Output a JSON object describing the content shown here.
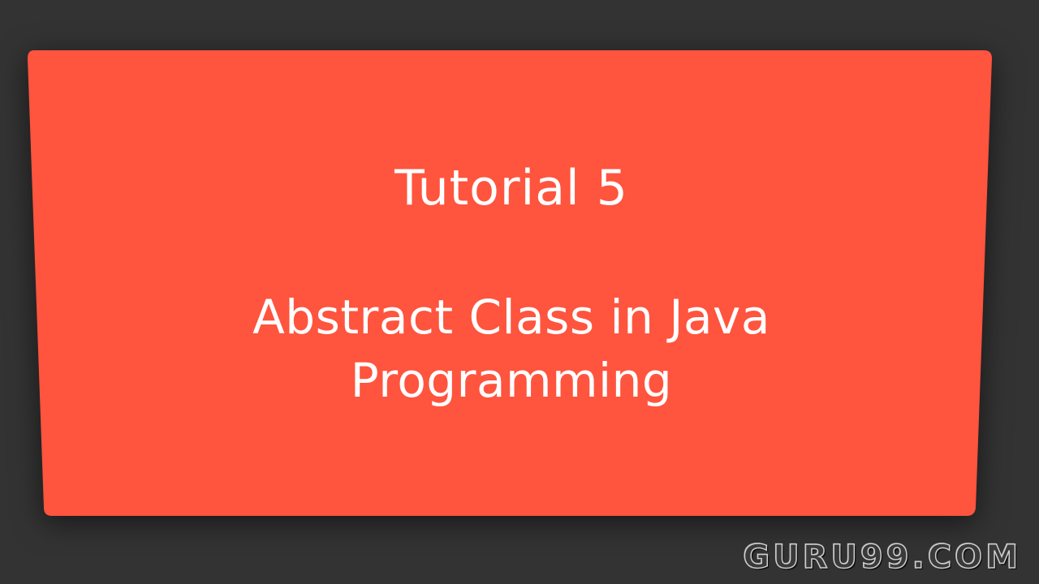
{
  "slide": {
    "background_color": "#333333",
    "card_color": "#FF543E",
    "heading": "Tutorial 5",
    "title_lines": [
      "Abstract Class in Java",
      "Programming"
    ]
  },
  "watermark": {
    "text": "GURU99.COM"
  }
}
